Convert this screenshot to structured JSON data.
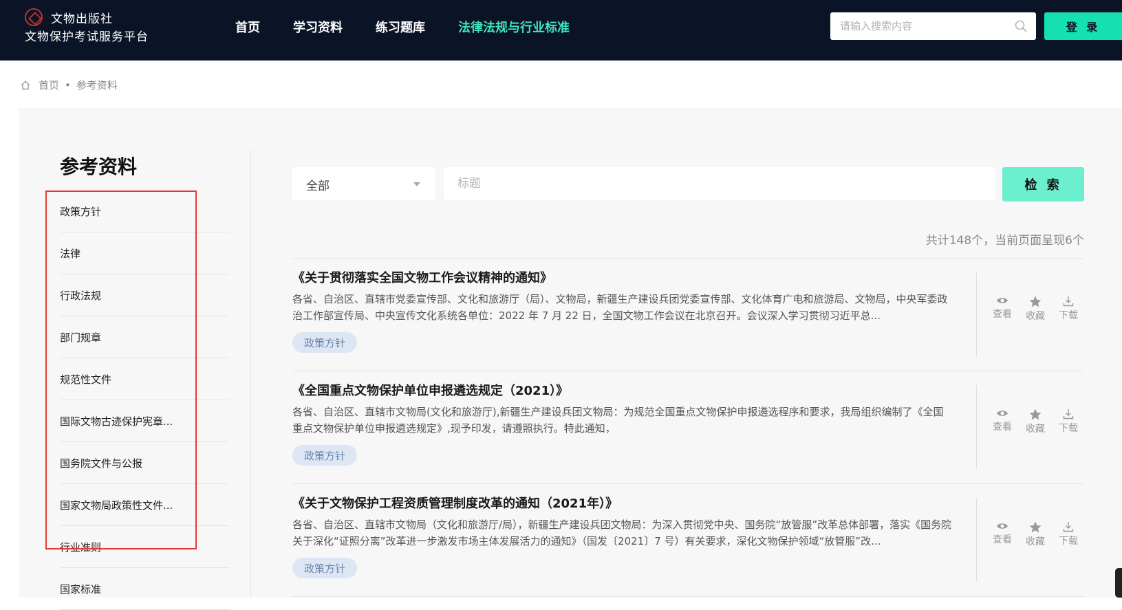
{
  "header": {
    "logo_line1": "文物出版社",
    "logo_line2": "文物保护考试服务平台",
    "nav": [
      "首页",
      "学习资料",
      "练习题库",
      "法律法规与行业标准"
    ],
    "search_placeholder": "请输入搜索内容",
    "login_label": "登 录",
    "accent_color": "#14e0b3",
    "active_nav_color": "#3fe4bf"
  },
  "breadcrumb": {
    "home": "首页",
    "sep": "•",
    "current": "参考资料"
  },
  "sidebar": {
    "title": "参考资料",
    "items": [
      "政策方针",
      "法律",
      "行政法规",
      "部门规章",
      "规范性文件",
      "国际文物古迹保护宪章...",
      "国务院文件与公报",
      "国家文物局政策性文件...",
      "行业准则",
      "国家标准"
    ]
  },
  "filter": {
    "category_value": "全部",
    "title_placeholder": "标题",
    "search_label": "检 索"
  },
  "count_text": "共计148个，当前页面呈现6个",
  "articles": [
    {
      "title": "《关于贯彻落实全国文物工作会议精神的通知》",
      "desc": "各省、自治区、直辖市党委宣传部、文化和旅游厅（局）、文物局，新疆生产建设兵团党委宣传部、文化体育广电和旅游局、文物局，中央军委政治工作部宣传局、中央宣传文化系统各单位：2022 年 7 月 22 日，全国文物工作会议在北京召开。会议深入学习贯彻习近平总...",
      "tag": "政策方针"
    },
    {
      "title": "《全国重点文物保护单位申报遴选规定（2021）》",
      "desc": "各省、自治区、直辖市文物局(文化和旅游厅),新疆生产建设兵团文物局：为规范全国重点文物保护申报遴选程序和要求，我局组织编制了《全国重点文物保护单位申报遴选规定》,现予印发，请遵照执行。特此通知，",
      "tag": "政策方针"
    },
    {
      "title": "《关于文物保护工程资质管理制度改革的通知（2021年）》",
      "desc": "各省、自治区、直辖市文物局（文化和旅游厅/局），新疆生产建设兵团文物局：为深入贯彻党中央、国务院“放管服”改革总体部署，落实《国务院关于深化“证照分离”改革进一步激发市场主体发展活力的通知》（国发〔2021〕7 号）有关要求，深化文物保护领域“放管服”改...",
      "tag": "政策方针"
    }
  ],
  "actions": {
    "view": "查看",
    "favorite": "收藏",
    "download": "下载"
  }
}
